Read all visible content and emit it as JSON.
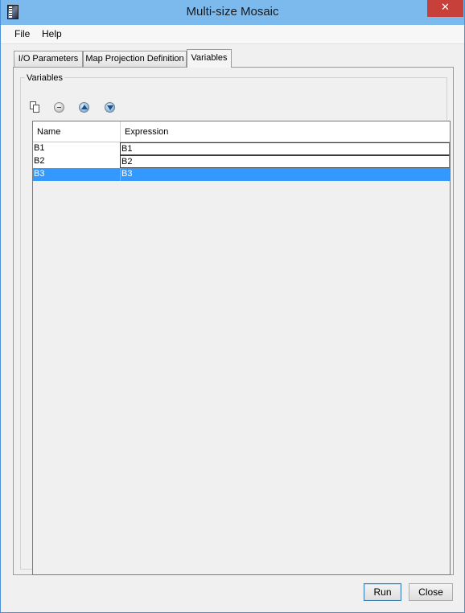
{
  "window": {
    "title": "Multi-size Mosaic",
    "close_glyph": "✕"
  },
  "menu": {
    "items": [
      "File",
      "Help"
    ]
  },
  "tabs": [
    {
      "label": "I/O Parameters",
      "active": false
    },
    {
      "label": "Map Projection Definition",
      "active": false
    },
    {
      "label": "Variables",
      "active": true
    }
  ],
  "variables": {
    "group_label": "Variables",
    "toolbar": [
      "copy-icon",
      "remove-icon",
      "move-up-icon",
      "move-down-icon"
    ],
    "columns": [
      "Name",
      "Expression"
    ],
    "rows": [
      {
        "name": "B1",
        "expression": "B1",
        "selected": false
      },
      {
        "name": "B2",
        "expression": "B2",
        "selected": false
      },
      {
        "name": "B3",
        "expression": "B3",
        "selected": true
      }
    ]
  },
  "buttons": {
    "run": "Run",
    "close": "Close"
  },
  "colors": {
    "titlebar": "#7cb9ec",
    "close_button": "#c7413a",
    "selection": "#3399ff"
  }
}
